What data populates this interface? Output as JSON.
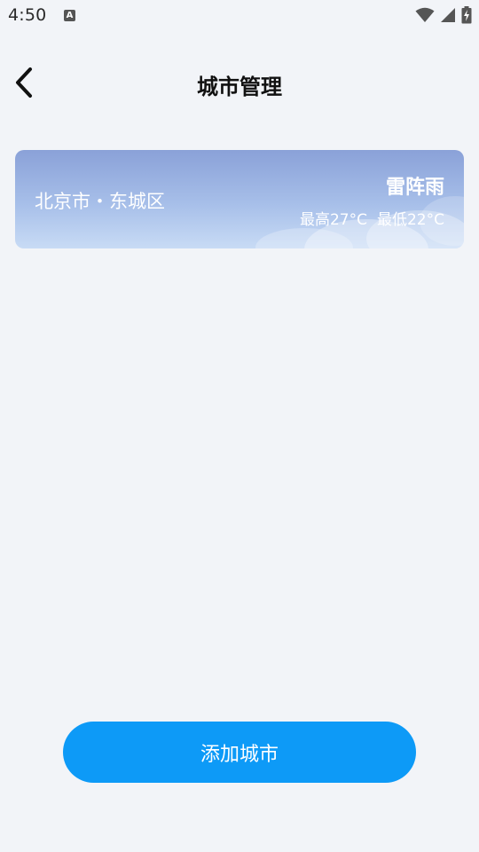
{
  "status_bar": {
    "time": "4:50",
    "notification_icon": "a-icon",
    "icons": [
      "wifi-icon",
      "signal-icon",
      "battery-charging-icon"
    ]
  },
  "header": {
    "title": "城市管理",
    "back_icon": "chevron-left-icon"
  },
  "city_card": {
    "city": "北京市・东城区",
    "condition": "雷阵雨",
    "high": "最高27°C",
    "low": "最低22°C"
  },
  "add_city_button": {
    "label": "添加城市"
  },
  "colors": {
    "background": "#f2f4f8",
    "accent": "#0d9af7",
    "card_top": "#8aa1d8",
    "card_bottom": "#c8dbf5"
  }
}
